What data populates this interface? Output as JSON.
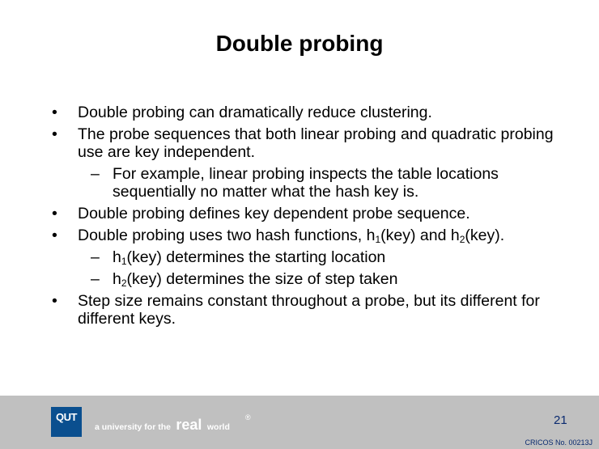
{
  "slide": {
    "title": "Double probing",
    "bullets": [
      {
        "level": 1,
        "marker": "•",
        "parts": [
          {
            "text": "Double probing can dramatically reduce clustering."
          }
        ]
      },
      {
        "level": 1,
        "marker": "•",
        "parts": [
          {
            "text": "The probe sequences that both linear probing and quadratic probing use are key independent."
          }
        ]
      },
      {
        "level": 2,
        "marker": "–",
        "parts": [
          {
            "text": "For example, linear probing inspects the table locations sequentially no matter what the hash key is."
          }
        ]
      },
      {
        "level": 1,
        "marker": "•",
        "parts": [
          {
            "text": "Double probing defines key dependent probe sequence."
          }
        ]
      },
      {
        "level": 1,
        "marker": "•",
        "parts": [
          {
            "text": "Double probing uses two hash functions, h"
          },
          {
            "text": "1",
            "sub": true
          },
          {
            "text": "(key) and h"
          },
          {
            "text": "2",
            "sub": true
          },
          {
            "text": "(key)."
          }
        ]
      },
      {
        "level": 2,
        "marker": "–",
        "parts": [
          {
            "text": "h"
          },
          {
            "text": "1",
            "sub": true
          },
          {
            "text": "(key) determines the starting location"
          }
        ]
      },
      {
        "level": 2,
        "marker": "–",
        "parts": [
          {
            "text": "h"
          },
          {
            "text": "2",
            "sub": true
          },
          {
            "text": "(key) determines the size of step taken"
          }
        ]
      },
      {
        "level": 1,
        "marker": "•",
        "parts": [
          {
            "text": "Step size remains constant throughout a probe, but its different for different keys."
          }
        ]
      }
    ]
  },
  "footer": {
    "logo_text": "QUT",
    "tagline_part1": "a university for the",
    "tagline_part2": "real",
    "tagline_part3": "world",
    "registered_mark": "®",
    "page_number": "21",
    "cricos": "CRICOS No. 00213J",
    "colors": {
      "background": "#c0c0c0",
      "logo": "#0a4f8f",
      "text_dark": "#0a2a6f"
    }
  }
}
